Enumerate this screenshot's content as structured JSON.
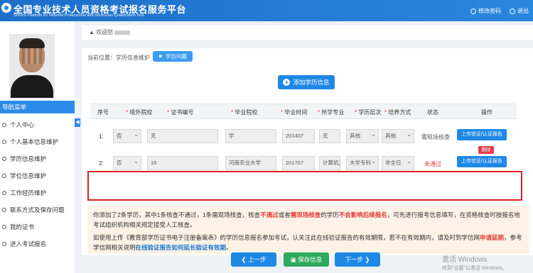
{
  "header": {
    "title_cn": "全国专业技术人员资格考试报名服务平台",
    "title_en": "Service Platform for National Professional and Technician Qualification Test",
    "actions": [
      "修改密码",
      "退出"
    ]
  },
  "sidebar": {
    "nav_title": "导航菜单",
    "items": [
      "个人中心",
      "个人基本信息维护",
      "学历信息维护",
      "学位信息维护",
      "工作经历维护",
      "联系方式及保存问题",
      "我的证书",
      "进入考试报名"
    ]
  },
  "welcome": {
    "text": "欢迎您"
  },
  "breadcrumb": {
    "label": "当前位置：学历信息维护",
    "tag": "学历问题"
  },
  "add_button": "添加学历信息",
  "table": {
    "headers": [
      {
        "text": "序号",
        "required": false
      },
      {
        "text": "境外院校",
        "required": true
      },
      {
        "text": "证书编号",
        "required": true
      },
      {
        "text": "毕业院校",
        "required": true
      },
      {
        "text": "毕业时间",
        "required": true
      },
      {
        "text": "所学专业",
        "required": true
      },
      {
        "text": "学历层次",
        "required": true
      },
      {
        "text": "培养方式",
        "required": true
      },
      {
        "text": "状态",
        "required": false
      },
      {
        "text": "操作",
        "required": false
      }
    ],
    "rows": [
      {
        "index": "1:",
        "overseas": "否",
        "cert_no": "无",
        "school": "学",
        "grad_time": "201407",
        "major": "无",
        "level": "其他",
        "mode": "其他",
        "status": "需现场核查",
        "action": "上传验证/认证报告"
      },
      {
        "index": "2:",
        "overseas": "否",
        "cert_no": "16",
        "school": "河南农业大学",
        "grad_time": "201707",
        "major": "计算机及",
        "level": "大学专科",
        "mode": "非全日",
        "status": "未通过",
        "delete": "删除",
        "action": "上传验证/认证报告"
      }
    ]
  },
  "notice": {
    "line1_a": "你添加了2条学历，其中1条核查不通过，1条需现场核查，核查",
    "line1_b": "不通过",
    "line1_c": "或者",
    "line1_d": "需现场核查",
    "line1_e": "的学历",
    "line1_f": "不会影响后续报名",
    "line1_g": "，可先进行报考信息填写，在资格核查时按报名地考试组织机构相关规定接受人工核查。",
    "line2_a": "如使用上传《教育部学历证书电子注册备案表》的学历信息报名参加考试，认关注此在线验证报告的有效期限，若不在有效期内，请及时到学信网",
    "line2_b": "申请延期",
    "line2_c": "，参考学信网相关说明",
    "line2_d": "在线验证报告如何延长验证有效期",
    "line2_e": "。"
  },
  "buttons": {
    "prev": "上一步",
    "save": "保存信息",
    "next": "下一步"
  },
  "watermark": {
    "title": "激活 Windows",
    "sub": "转到\"设置\"以激活 Windows。"
  },
  "colors": {
    "primary": "#1e88e5",
    "header": "#2a86dc",
    "danger": "#e53935",
    "save": "#2eaa5c"
  }
}
